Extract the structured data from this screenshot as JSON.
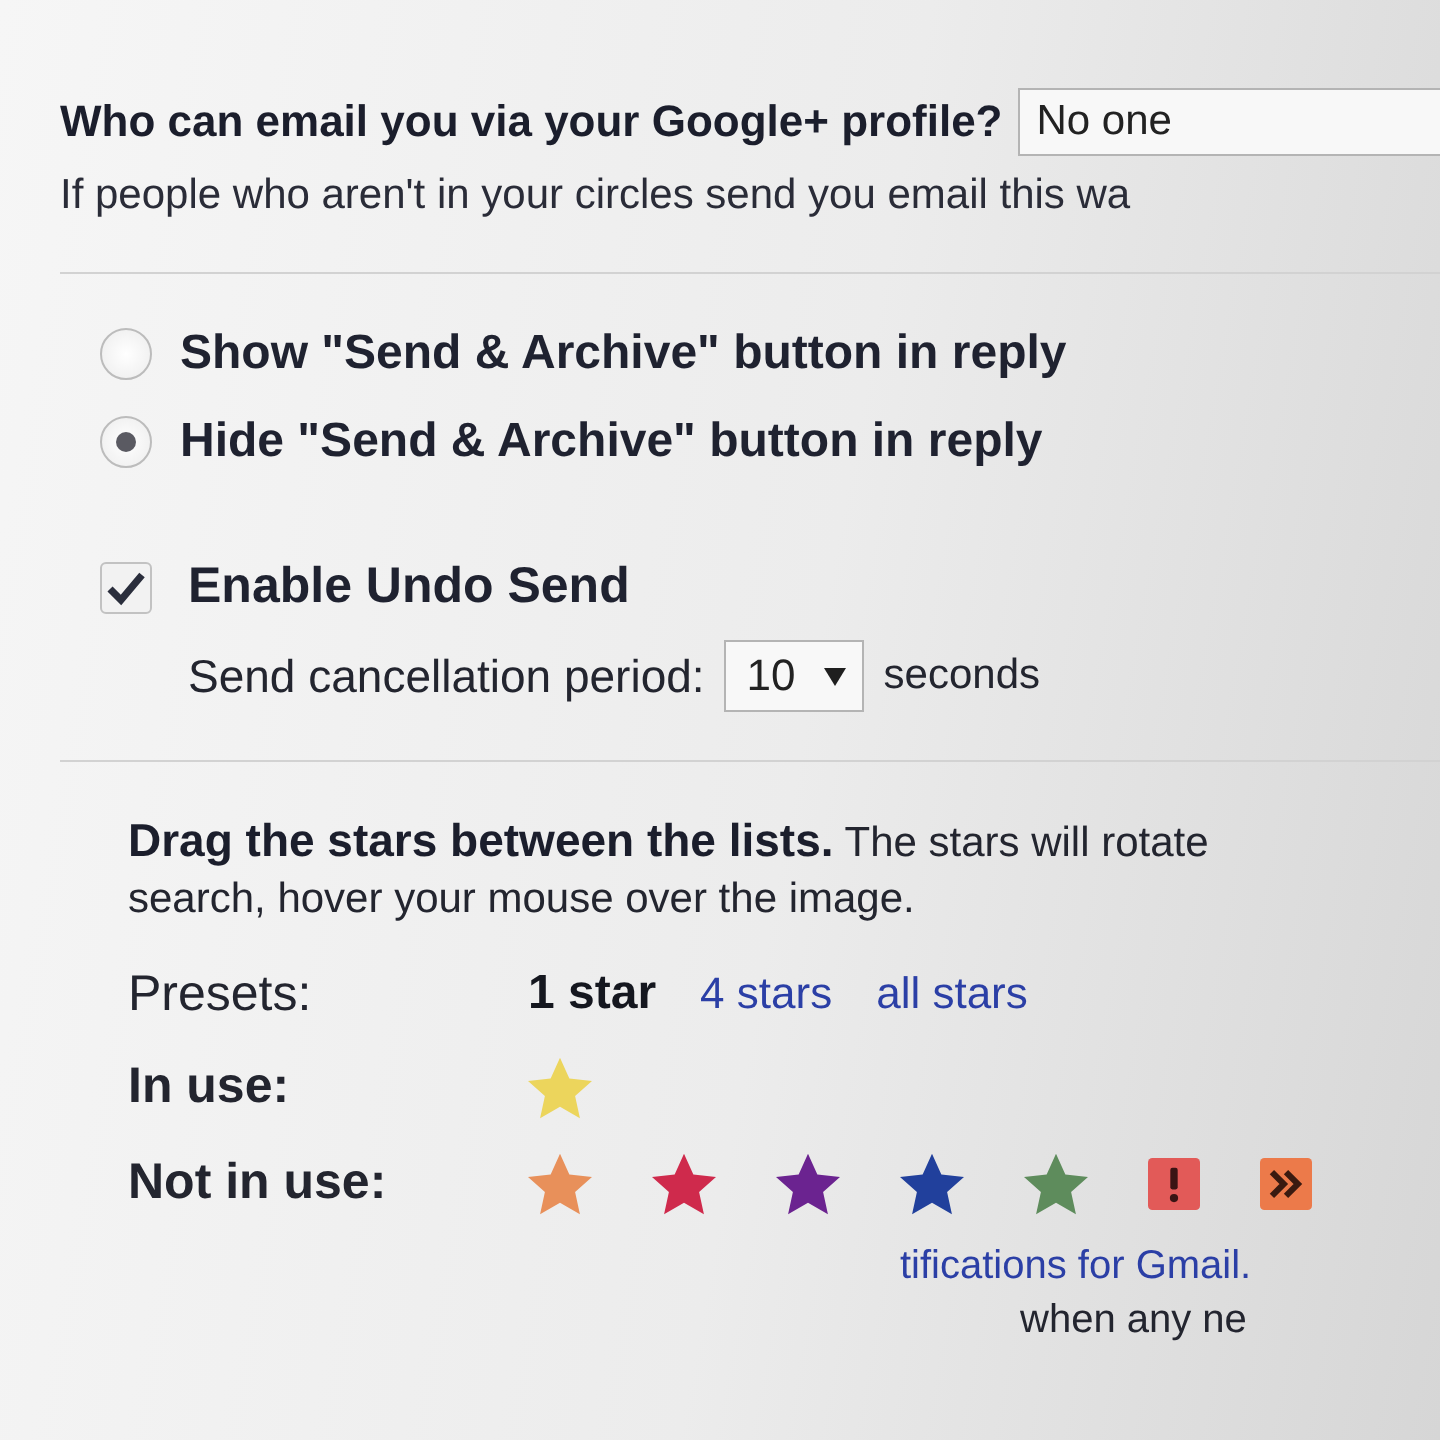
{
  "google_plus_email": {
    "question": "Who can email you via your Google+ profile?",
    "select": {
      "value": "No one"
    },
    "description": "If people who aren't in your circles send you email this wa"
  },
  "send_archive": [
    {
      "label": "Show \"Send & Archive\" button in reply",
      "selected": false
    },
    {
      "label": "Hide \"Send & Archive\" button in reply",
      "selected": true
    }
  ],
  "undo_send": {
    "label": "Enable Undo Send",
    "checked": true,
    "period_label": "Send cancellation period:",
    "period_select": {
      "value": "10"
    },
    "unit": "seconds"
  },
  "star_settings": {
    "intro_lines": [
      "**Drag the stars between the lists.** The stars will rotate",
      "search, hover your mouse over the image."
    ],
    "presets_label": "Presets:",
    "presets": [
      {
        "label": "1 star",
        "selected": true
      },
      {
        "label": "4 stars",
        "selected": false
      },
      {
        "label": "all stars",
        "selected": false
      }
    ],
    "in_use_label": "In use:",
    "in_use": [
      {
        "kind": "star",
        "color": "#ecd55c"
      }
    ],
    "not_in_use_label": "Not in use:",
    "not_in_use": [
      {
        "kind": "star",
        "color": "#e8905a"
      },
      {
        "kind": "star",
        "color": "#cf2a4c"
      },
      {
        "kind": "star",
        "color": "#6b2390"
      },
      {
        "kind": "star",
        "color": "#21409c"
      },
      {
        "kind": "star",
        "color": "#5e8c5c"
      },
      {
        "kind": "exclamation",
        "color": "#e25a58"
      },
      {
        "kind": "guillemet",
        "color": "#ec7a4a"
      }
    ]
  },
  "notifications": {
    "link": "tifications for Gmail.",
    "text": "when any ne"
  }
}
